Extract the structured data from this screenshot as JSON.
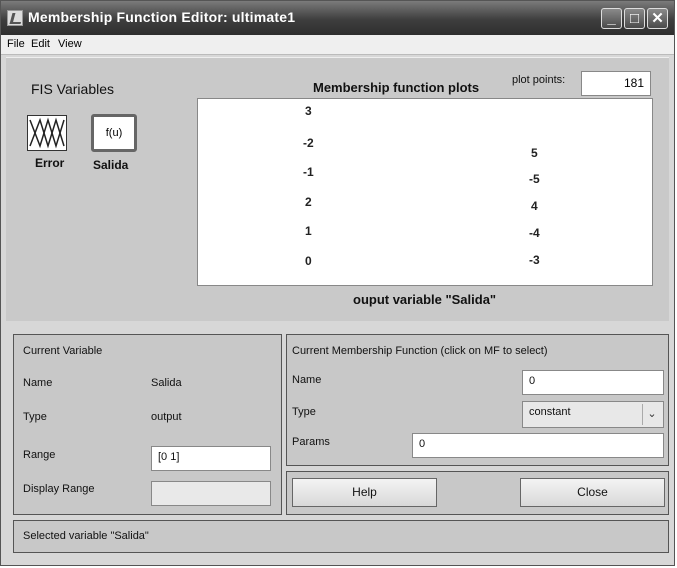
{
  "window": {
    "title": "Membership Function Editor: ultimate1"
  },
  "menu": [
    "File",
    "Edit",
    "View"
  ],
  "fis_variables": {
    "heading": "FIS Variables",
    "input": {
      "label": "Error"
    },
    "output": {
      "label": "Salida",
      "box_text": "f(u)"
    }
  },
  "plot": {
    "title": "Membership function plots",
    "plot_points_label": "plot points:",
    "plot_points_value": "181",
    "left_mfs": [
      "3",
      "-2",
      "-1",
      "2",
      "1",
      "0"
    ],
    "right_mfs": [
      "5",
      "-5",
      "4",
      "-4",
      "-3"
    ],
    "xlabel": "ouput variable \"Salida\""
  },
  "current_variable": {
    "heading": "Current Variable",
    "name_label": "Name",
    "name_value": "Salida",
    "type_label": "Type",
    "type_value": "output",
    "range_label": "Range",
    "range_value": "[0 1]",
    "display_range_label": "Display Range",
    "display_range_value": ""
  },
  "current_mf": {
    "heading": "Current Membership Function (click on MF to select)",
    "name_label": "Name",
    "name_value": "0",
    "type_label": "Type",
    "type_value": "constant",
    "params_label": "Params",
    "params_value": "0"
  },
  "buttons": {
    "help": "Help",
    "close": "Close"
  },
  "status": "Selected variable \"Salida\""
}
